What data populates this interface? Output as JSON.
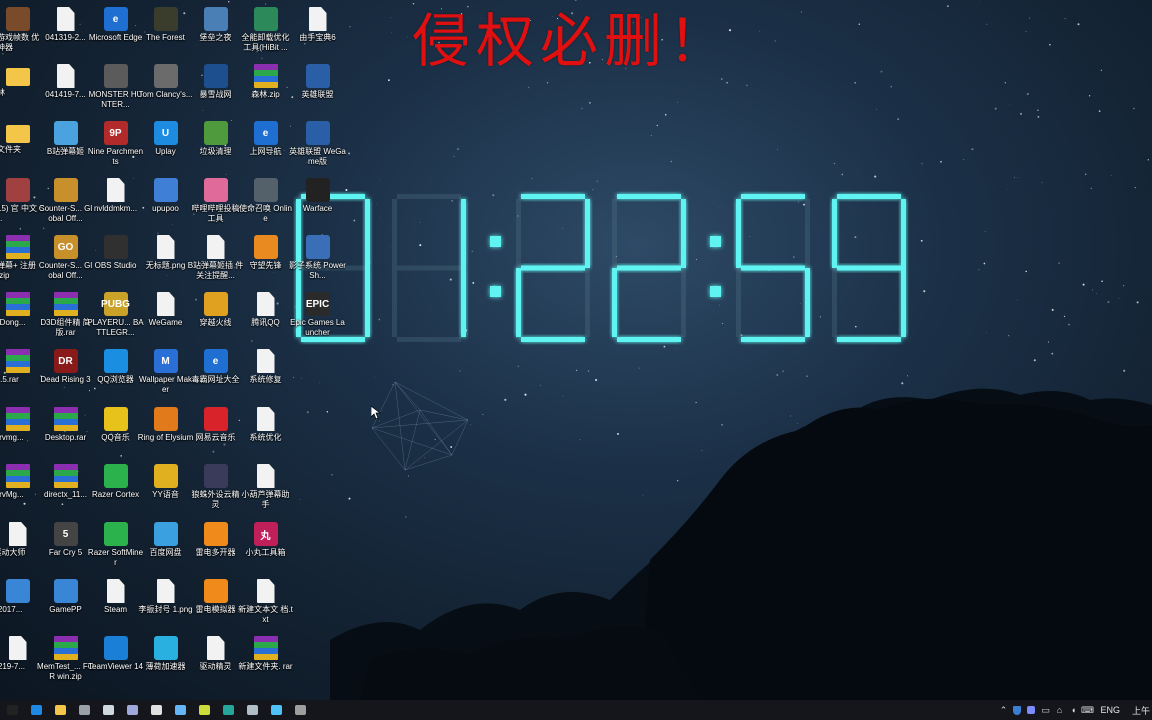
{
  "watermark": "侵权必删！",
  "clock": {
    "time": "01:22:59"
  },
  "icons": [
    {
      "col": 0,
      "row": 0,
      "type": "app",
      "color": "#7a4b2a",
      "label": "级游戏帧数\n优化神器",
      "cut": true
    },
    {
      "col": 1,
      "row": 0,
      "type": "doc",
      "label": "041319-2..."
    },
    {
      "col": 2,
      "row": 0,
      "type": "app",
      "color": "#1e6fd1",
      "glyph": "e",
      "label": "Microsoft\nEdge"
    },
    {
      "col": 3,
      "row": 0,
      "type": "app",
      "color": "#3b3d2c",
      "label": "The Forest"
    },
    {
      "col": 4,
      "row": 0,
      "type": "app",
      "color": "#4a7fb5",
      "label": "堡垒之夜"
    },
    {
      "col": 5,
      "row": 0,
      "type": "app",
      "color": "#2c8a5a",
      "label": "全能卸载优化\n工具(HiBit ..."
    },
    {
      "col": 6,
      "row": 0,
      "type": "doc",
      "label": "由手宝典6"
    },
    {
      "col": 0,
      "row": 1,
      "type": "folder",
      "label": "森林",
      "cut": true
    },
    {
      "col": 1,
      "row": 1,
      "type": "doc",
      "label": "041419-7..."
    },
    {
      "col": 2,
      "row": 1,
      "type": "app",
      "color": "#5b5b5b",
      "label": "MONSTER\nHUNTER..."
    },
    {
      "col": 3,
      "row": 1,
      "type": "app",
      "color": "#6b6b6b",
      "label": "Tom\nClancy's..."
    },
    {
      "col": 4,
      "row": 1,
      "type": "app",
      "color": "#1d4f8f",
      "label": "暴雪战网"
    },
    {
      "col": 5,
      "row": 1,
      "type": "zip",
      "label": "森林.zip"
    },
    {
      "col": 6,
      "row": 1,
      "type": "app",
      "color": "#2a5fa8",
      "label": "英雄联盟"
    },
    {
      "col": 0,
      "row": 2,
      "type": "folder",
      "label": "建文件夹",
      "cut": true
    },
    {
      "col": 1,
      "row": 2,
      "type": "app",
      "color": "#4aa3df",
      "label": "B站弹幕姬"
    },
    {
      "col": 2,
      "row": 2,
      "type": "app",
      "color": "#b32a2a",
      "glyph": "9P",
      "label": "Nine\nParchments"
    },
    {
      "col": 3,
      "row": 2,
      "type": "app",
      "color": "#1c8be0",
      "glyph": "U",
      "label": "Uplay"
    },
    {
      "col": 4,
      "row": 2,
      "type": "app",
      "color": "#4f9a3c",
      "label": "垃圾清理"
    },
    {
      "col": 5,
      "row": 2,
      "type": "app",
      "color": "#1e6fd1",
      "glyph": "e",
      "label": "上网导航"
    },
    {
      "col": 6,
      "row": 2,
      "type": "app",
      "color": "#2a5fa8",
      "label": "英雄联盟\nWeGame版"
    },
    {
      "col": 0,
      "row": 3,
      "type": "app",
      "color": "#a04040",
      "label": "魂15) 官\n中文 Ste...",
      "cut": true
    },
    {
      "col": 1,
      "row": 3,
      "type": "app",
      "color": "#c8902a",
      "label": "Counter-S...\nGlobal Off..."
    },
    {
      "col": 2,
      "row": 3,
      "type": "doc",
      "label": "nvlddmkm..."
    },
    {
      "col": 3,
      "row": 3,
      "type": "app",
      "color": "#3f7fd6",
      "label": "upupoo"
    },
    {
      "col": 4,
      "row": 3,
      "type": "app",
      "color": "#e06a9a",
      "label": "哔哩哔哩投稿\n工具"
    },
    {
      "col": 5,
      "row": 3,
      "type": "app",
      "color": "#54606a",
      "label": "使命召唤\nOnline"
    },
    {
      "col": 6,
      "row": 3,
      "type": "app",
      "color": "#222222",
      "label": "Warface"
    },
    {
      "col": 0,
      "row": 4,
      "type": "zip",
      "label": "幕弹幕+\n注册表.zip",
      "cut": true
    },
    {
      "col": 1,
      "row": 4,
      "type": "app",
      "color": "#c8902a",
      "glyph": "GO",
      "label": "Counter-S...\nGlobal Off..."
    },
    {
      "col": 2,
      "row": 4,
      "type": "app",
      "color": "#303030",
      "label": "OBS Studio"
    },
    {
      "col": 3,
      "row": 4,
      "type": "doc",
      "label": "无标题.png"
    },
    {
      "col": 4,
      "row": 4,
      "type": "doc",
      "label": "B站弹幕姬插\n件关注提醒..."
    },
    {
      "col": 5,
      "row": 4,
      "type": "app",
      "color": "#e88a20",
      "label": "守望先锋"
    },
    {
      "col": 6,
      "row": 4,
      "type": "app",
      "color": "#3a6fb8",
      "label": "影子系统\nPowerSh..."
    },
    {
      "col": 0,
      "row": 5,
      "type": "zip",
      "label": "QuDong...",
      "cut": true
    },
    {
      "col": 1,
      "row": 5,
      "type": "zip",
      "label": "D3D组件精\n简版.rar"
    },
    {
      "col": 2,
      "row": 5,
      "type": "app",
      "color": "#c9a227",
      "glyph": "PUBG",
      "label": "PLAYERU...\nBATTLEGR..."
    },
    {
      "col": 3,
      "row": 5,
      "type": "doc",
      "label": "WeGame"
    },
    {
      "col": 4,
      "row": 5,
      "type": "app",
      "color": "#e0a020",
      "label": "穿越火线"
    },
    {
      "col": 5,
      "row": 5,
      "type": "doc",
      "label": "腾讯QQ"
    },
    {
      "col": 6,
      "row": 5,
      "type": "app",
      "color": "#2a2a2a",
      "glyph": "EPIC",
      "label": "Epic Games\nLauncher"
    },
    {
      "col": 0,
      "row": 6,
      "type": "zip",
      "label": "9.7.5.rar",
      "cut": true
    },
    {
      "col": 1,
      "row": 6,
      "type": "app",
      "color": "#8a1a1a",
      "glyph": "DR",
      "label": "Dead Rising\n3"
    },
    {
      "col": 2,
      "row": 6,
      "type": "app",
      "color": "#1a8ee0",
      "label": "QQ浏览器"
    },
    {
      "col": 3,
      "row": 6,
      "type": "app",
      "color": "#2a6fd6",
      "glyph": "M",
      "label": "Wallpaper\nMaker"
    },
    {
      "col": 4,
      "row": 6,
      "type": "app",
      "color": "#1e6fd1",
      "glyph": "e",
      "label": "毒霸网址大全"
    },
    {
      "col": 5,
      "row": 6,
      "type": "doc",
      "label": "系统修复"
    },
    {
      "col": 0,
      "row": 7,
      "type": "zip",
      "label": "0Drvmg...",
      "cut": true
    },
    {
      "col": 1,
      "row": 7,
      "type": "zip",
      "label": "Desktop.rar"
    },
    {
      "col": 2,
      "row": 7,
      "type": "app",
      "color": "#e6c21a",
      "label": "QQ音乐"
    },
    {
      "col": 3,
      "row": 7,
      "type": "app",
      "color": "#e07a1a",
      "label": "Ring of\nElysium"
    },
    {
      "col": 4,
      "row": 7,
      "type": "app",
      "color": "#d8232a",
      "label": "网易云音乐"
    },
    {
      "col": 5,
      "row": 7,
      "type": "doc",
      "label": "系统优化"
    },
    {
      "col": 0,
      "row": 8,
      "type": "zip",
      "label": "0DrvMg...",
      "cut": true
    },
    {
      "col": 1,
      "row": 8,
      "type": "zip",
      "label": "directx_11..."
    },
    {
      "col": 2,
      "row": 8,
      "type": "app",
      "color": "#2bb24c",
      "label": "Razer\nCortex"
    },
    {
      "col": 3,
      "row": 8,
      "type": "app",
      "color": "#e0b020",
      "label": "YY语音"
    },
    {
      "col": 4,
      "row": 8,
      "type": "app",
      "color": "#3a3a5a",
      "label": "狼蛛外设云精\n灵"
    },
    {
      "col": 5,
      "row": 8,
      "type": "doc",
      "label": "小葫芦弹幕助\n手"
    },
    {
      "col": 0,
      "row": 9,
      "type": "doc",
      "label": "0驱动大师",
      "cut": true
    },
    {
      "col": 1,
      "row": 9,
      "type": "app",
      "color": "#444444",
      "glyph": "5",
      "label": "Far Cry 5"
    },
    {
      "col": 2,
      "row": 9,
      "type": "app",
      "color": "#2bb24c",
      "label": "Razer\nSoftMiner"
    },
    {
      "col": 3,
      "row": 9,
      "type": "app",
      "color": "#3aa0e0",
      "label": "百度网盘"
    },
    {
      "col": 4,
      "row": 9,
      "type": "app",
      "color": "#f08a1a",
      "label": "雷电多开器"
    },
    {
      "col": 5,
      "row": 9,
      "type": "app",
      "color": "#c0205a",
      "glyph": "丸",
      "label": "小丸工具箱"
    },
    {
      "col": 0,
      "row": 10,
      "type": "app",
      "color": "#3a86d6",
      "label": "7_2017...",
      "cut": true
    },
    {
      "col": 1,
      "row": 10,
      "type": "app",
      "color": "#3a86d6",
      "label": "GamePP"
    },
    {
      "col": 2,
      "row": 10,
      "type": "doc",
      "label": "Steam"
    },
    {
      "col": 3,
      "row": 10,
      "type": "doc",
      "label": "李振封号\n1.png"
    },
    {
      "col": 4,
      "row": 10,
      "type": "app",
      "color": "#f08a1a",
      "label": "雷电模拟器"
    },
    {
      "col": 5,
      "row": 10,
      "type": "doc",
      "label": "新建文本文\n档.txt"
    },
    {
      "col": 0,
      "row": 11,
      "type": "doc",
      "label": "41219-7...",
      "cut": true
    },
    {
      "col": 1,
      "row": 11,
      "type": "zip",
      "label": "MemTest_...\nFOR win.zip"
    },
    {
      "col": 2,
      "row": 11,
      "type": "app",
      "color": "#1a7fd6",
      "label": "TeamViewer\n14"
    },
    {
      "col": 3,
      "row": 11,
      "type": "app",
      "color": "#2ab0e0",
      "label": "薄荷加速器"
    },
    {
      "col": 4,
      "row": 11,
      "type": "doc",
      "label": "驱动精灵"
    },
    {
      "col": 5,
      "row": 11,
      "type": "zip",
      "label": "新建文件夹.\nrar"
    }
  ],
  "taskbar": {
    "apps": [
      {
        "name": "start-button",
        "color": "#222222"
      },
      {
        "name": "edge-taskbar-button",
        "color": "#1e88e5"
      },
      {
        "name": "file-explorer-taskbar-button",
        "color": "#f3c64a"
      },
      {
        "name": "store-taskbar-button",
        "color": "#9aa0a6"
      },
      {
        "name": "mail-taskbar-button",
        "color": "#cfd8dc"
      },
      {
        "name": "photos-taskbar-button",
        "color": "#9fa8da"
      },
      {
        "name": "app-taskbar-button-6",
        "color": "#e0e0e0"
      },
      {
        "name": "app-taskbar-button-7",
        "color": "#64b5f6"
      },
      {
        "name": "app-taskbar-button-8",
        "color": "#cddc39"
      },
      {
        "name": "app-taskbar-button-9",
        "color": "#26a69a"
      },
      {
        "name": "app-taskbar-button-10",
        "color": "#b0bec5"
      },
      {
        "name": "app-taskbar-button-11",
        "color": "#4fc3f7"
      },
      {
        "name": "app-taskbar-button-12",
        "color": "#9e9e9e"
      }
    ],
    "language": "ENG",
    "clock_partial": "上午"
  },
  "colors": {
    "clock_glow": "#5ff4f2",
    "watermark": "#e01010"
  }
}
